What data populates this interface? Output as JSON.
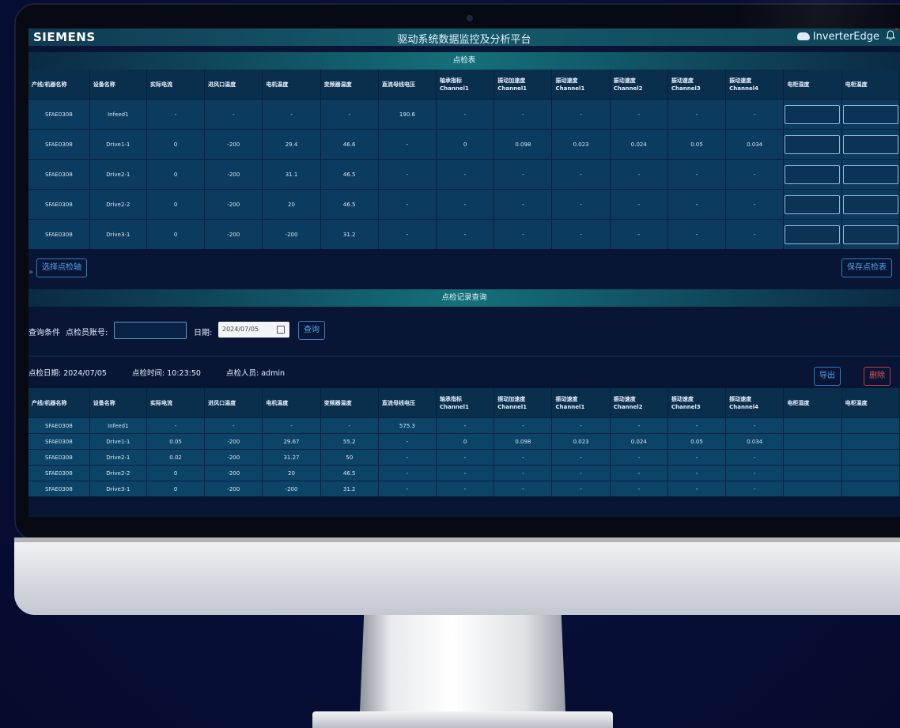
{
  "header": {
    "brand": "SIEMENS",
    "title": "驱动系统数据监控及分析平台",
    "product": "InverterEdge"
  },
  "inspection_table": {
    "title": "点检表",
    "columns": [
      "产线/机器名称",
      "设备名称",
      "实际电流",
      "进风口温度",
      "电机温度",
      "变频器温度",
      "直流母线电压",
      "轴承指标Channel1",
      "振动加速度Channel1",
      "振动速度Channel1",
      "振动速度Channel2",
      "振动速度Channel3",
      "振动速度Channel4",
      "电柜湿度",
      "电柜温度"
    ],
    "rows": [
      [
        "SFAE0308",
        "Infeed1",
        "-",
        "-",
        "-",
        "-",
        "190.6",
        "-",
        "-",
        "-",
        "-",
        "-",
        "-"
      ],
      [
        "SFAE0308",
        "Drive1-1",
        "0",
        "-200",
        "29.4",
        "46.6",
        "-",
        "0",
        "0.098",
        "0.023",
        "0.024",
        "0.05",
        "0.034"
      ],
      [
        "SFAE0308",
        "Drive2-1",
        "0",
        "-200",
        "31.1",
        "46.5",
        "-",
        "-",
        "-",
        "-",
        "-",
        "-",
        "-"
      ],
      [
        "SFAE0308",
        "Drive2-2",
        "0",
        "-200",
        "20",
        "46.5",
        "-",
        "-",
        "-",
        "-",
        "-",
        "-",
        "-"
      ],
      [
        "SFAE0308",
        "Drive3-1",
        "0",
        "-200",
        "-200",
        "31.2",
        "-",
        "-",
        "-",
        "-",
        "-",
        "-",
        "-"
      ]
    ],
    "select_axis_button": "选择点检轴",
    "save_button": "保存点检表"
  },
  "record_query": {
    "title": "点检记录查询",
    "condition_label": "查询条件",
    "account_label": "点检员账号:",
    "account_value": "",
    "date_label": "日期:",
    "date_value": "2024/07/05",
    "query_button": "查询",
    "inspect_date": "点检日期: 2024/07/05",
    "inspect_time": "点检时间: 10:23:50",
    "inspector": "点检人员: admin",
    "export_button": "导出",
    "delete_button": "删除",
    "rows": [
      [
        "SFAE0308",
        "Infeed1",
        "-",
        "-",
        "-",
        "-",
        "575.3",
        "-",
        "-",
        "-",
        "-",
        "-",
        "-",
        "",
        ""
      ],
      [
        "SFAE0308",
        "Drive1-1",
        "0.05",
        "-200",
        "29.67",
        "55.2",
        "-",
        "0",
        "0.098",
        "0.023",
        "0.024",
        "0.05",
        "0.034",
        "",
        ""
      ],
      [
        "SFAE0308",
        "Drive2-1",
        "0.02",
        "-200",
        "31.27",
        "50",
        "-",
        "-",
        "-",
        "-",
        "-",
        "-",
        "-",
        "",
        ""
      ],
      [
        "SFAE0308",
        "Drive2-2",
        "0",
        "-200",
        "20",
        "46.5",
        "-",
        "-",
        "-",
        "-",
        "-",
        "-",
        "-",
        "",
        ""
      ],
      [
        "SFAE0308",
        "Drive3-1",
        "0",
        "-200",
        "-200",
        "31.2",
        "-",
        "-",
        "-",
        "-",
        "-",
        "-",
        "-",
        "",
        ""
      ]
    ]
  }
}
